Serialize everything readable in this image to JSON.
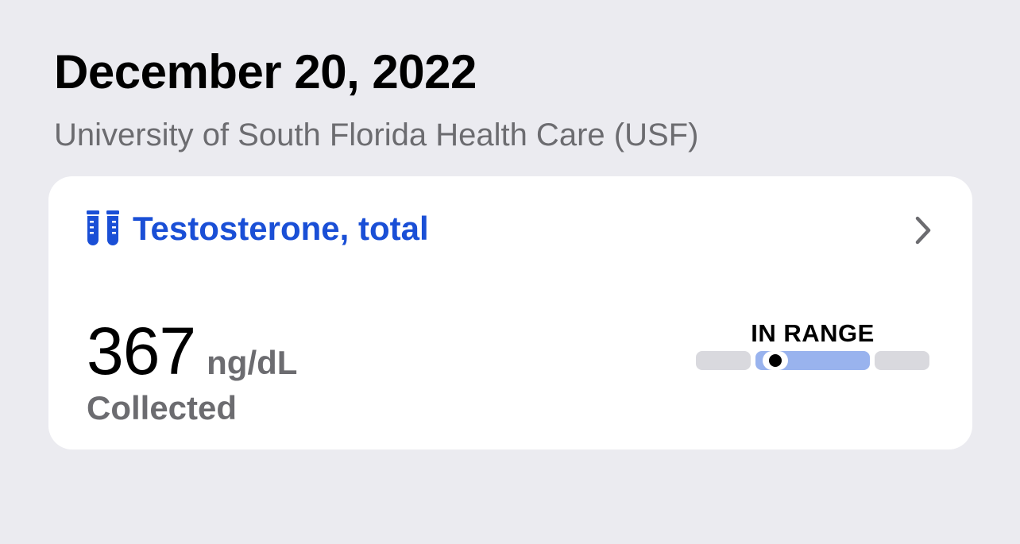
{
  "header": {
    "date": "December 20, 2022",
    "provider": "University of South Florida Health Care (USF)"
  },
  "lab_result": {
    "icon": "test-tubes-icon",
    "test_name": "Testosterone, total",
    "value": "367",
    "unit": "ng/dL",
    "status_text": "Collected",
    "range_label": "IN RANGE",
    "range_position_fraction": 0.34,
    "colors": {
      "accent": "#1a4fd6",
      "in_range_segment": "#99b3ee",
      "out_of_range_segment": "#d9d9de",
      "marker": "#000000"
    }
  }
}
